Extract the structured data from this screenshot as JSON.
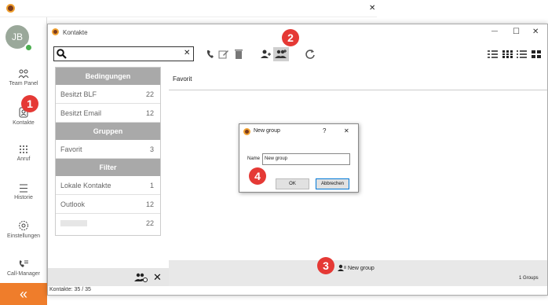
{
  "outer": {
    "avatar_initials": "JB",
    "close_glyph": "✕",
    "nav": [
      {
        "label": "Team Panel"
      },
      {
        "label": "Kontakte"
      },
      {
        "label": "Anruf"
      },
      {
        "label": "Historie"
      },
      {
        "label": "Einstellungen"
      },
      {
        "label": "Call-Manager"
      }
    ],
    "collapse_glyph": "«"
  },
  "window": {
    "title": "Kontakte",
    "controls": {
      "minimize": "—",
      "maximize": "☐",
      "close": "✕"
    },
    "search": {
      "value": "",
      "clear_glyph": "✕"
    },
    "sections": [
      {
        "header": "Bedingungen",
        "items": [
          {
            "label": "Besitzt BLF",
            "count": "22"
          },
          {
            "label": "Besitzt Email",
            "count": "12"
          }
        ]
      },
      {
        "header": "Gruppen",
        "items": [
          {
            "label": "Favorit",
            "count": "3"
          }
        ]
      },
      {
        "header": "Filter",
        "items": [
          {
            "label": "Lokale Kontakte",
            "count": "1"
          },
          {
            "label": "Outlook",
            "count": "12"
          },
          {
            "label": "",
            "count": "22"
          }
        ]
      }
    ],
    "right_header": "Favorit",
    "new_group_entry": "New group",
    "groups_count": "1 Groups",
    "status": "Kontakte: 35 / 35",
    "left_footer_close": "✕"
  },
  "dialog": {
    "title": "New group",
    "help": "?",
    "close": "✕",
    "name_label": "Name",
    "name_value": "New group",
    "ok": "OK",
    "cancel": "Abbrechen"
  },
  "callouts": [
    "1",
    "2",
    "3",
    "4"
  ],
  "colors": {
    "accent": "#ef7d2b",
    "badge": "#e53935",
    "section_header": "#a9a9a9",
    "status_online": "#4caf50"
  }
}
